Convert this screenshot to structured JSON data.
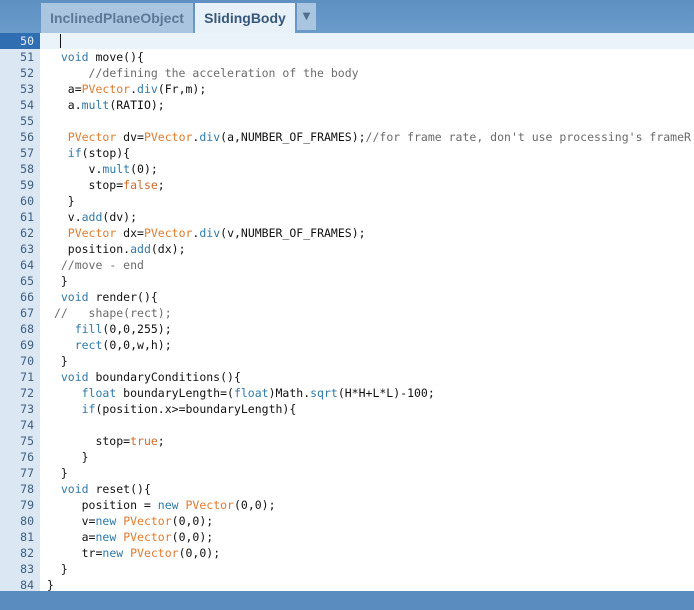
{
  "tabs": [
    {
      "label": "InclinedPlaneObject",
      "active": false
    },
    {
      "label": "SlidingBody",
      "active": true
    }
  ],
  "tab_menu_icon": "dropdown-arrow-icon",
  "tab_menu_glyph": "▼",
  "editor": {
    "current_line": 50,
    "lines": [
      {
        "n": "50",
        "text": ""
      },
      {
        "n": "51",
        "text": "  void move(){"
      },
      {
        "n": "52",
        "text": "      //defining the acceleration of the body"
      },
      {
        "n": "53",
        "text": "   a=PVector.div(Fr,m);"
      },
      {
        "n": "54",
        "text": "   a.mult(RATIO);"
      },
      {
        "n": "55",
        "text": ""
      },
      {
        "n": "56",
        "text": "   PVector dv=PVector.div(a,NUMBER_OF_FRAMES);//for frame rate, don't use processing's frameR"
      },
      {
        "n": "57",
        "text": "   if(stop){"
      },
      {
        "n": "58",
        "text": "      v.mult(0);"
      },
      {
        "n": "59",
        "text": "      stop=false;"
      },
      {
        "n": "60",
        "text": "   }"
      },
      {
        "n": "61",
        "text": "   v.add(dv);"
      },
      {
        "n": "62",
        "text": "   PVector dx=PVector.div(v,NUMBER_OF_FRAMES);"
      },
      {
        "n": "63",
        "text": "   position.add(dx);"
      },
      {
        "n": "64",
        "text": "  //move - end"
      },
      {
        "n": "65",
        "text": "  }"
      },
      {
        "n": "66",
        "text": "  void render(){"
      },
      {
        "n": "67",
        "text": " //   shape(rect);"
      },
      {
        "n": "68",
        "text": "    fill(0,0,255);"
      },
      {
        "n": "69",
        "text": "    rect(0,0,w,h);"
      },
      {
        "n": "70",
        "text": "  }"
      },
      {
        "n": "71",
        "text": "  void boundaryConditions(){"
      },
      {
        "n": "72",
        "text": "     float boundaryLength=(float)Math.sqrt(H*H+L*L)-100;"
      },
      {
        "n": "73",
        "text": "     if(position.x>=boundaryLength){"
      },
      {
        "n": "74",
        "text": ""
      },
      {
        "n": "75",
        "text": "       stop=true;"
      },
      {
        "n": "76",
        "text": "     }"
      },
      {
        "n": "77",
        "text": "  }"
      },
      {
        "n": "78",
        "text": "  void reset(){"
      },
      {
        "n": "79",
        "text": "     position = new PVector(0,0);"
      },
      {
        "n": "80",
        "text": "     v=new PVector(0,0);"
      },
      {
        "n": "81",
        "text": "     a=new PVector(0,0);"
      },
      {
        "n": "82",
        "text": "     tr=new PVector(0,0);"
      },
      {
        "n": "83",
        "text": "  }"
      },
      {
        "n": "84",
        "text": "}"
      }
    ]
  },
  "colors": {
    "keyword": "#2f7aa8",
    "type": "#e07b2e",
    "comment": "#6b6b6b",
    "current_line_number_bg": "#2f6fb1"
  }
}
